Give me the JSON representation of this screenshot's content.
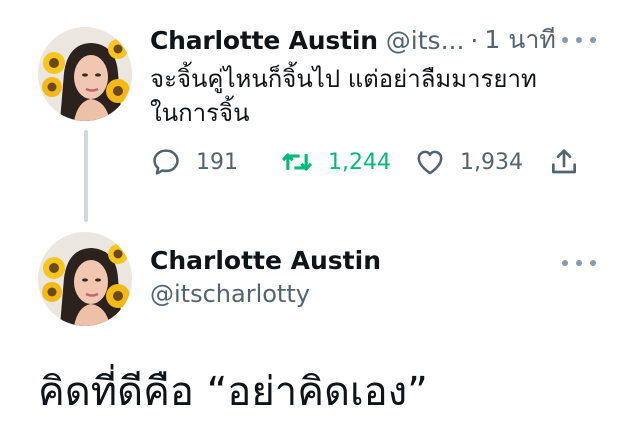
{
  "reply_tweet": {
    "display_name": "Charlotte Austin",
    "handle_truncated": "@its...",
    "separator": "·",
    "time": "1 นาที",
    "text_lines": [
      "จะจิ้นคู่ไหนก็จิ้นไป แต่อย่าลืมมารยาท",
      "ในการจิ้น"
    ],
    "stats": {
      "replies": "191",
      "retweets": "1,244",
      "likes": "1,934"
    }
  },
  "main_tweet": {
    "display_name": "Charlotte Austin",
    "handle": "@itscharlotty",
    "text": "คิดที่ดีคือ “อย่าคิดเอง”"
  },
  "colors": {
    "text_primary": "#0f1419",
    "text_secondary": "#536471",
    "retweet_green": "#00ba7c",
    "thread_line": "#cfd9de"
  },
  "icons": {
    "reply": "speech-bubble-icon",
    "retweet": "retweet-arrows-icon",
    "like": "heart-outline-icon",
    "share": "share-upload-icon",
    "more": "more-dots-icon"
  }
}
